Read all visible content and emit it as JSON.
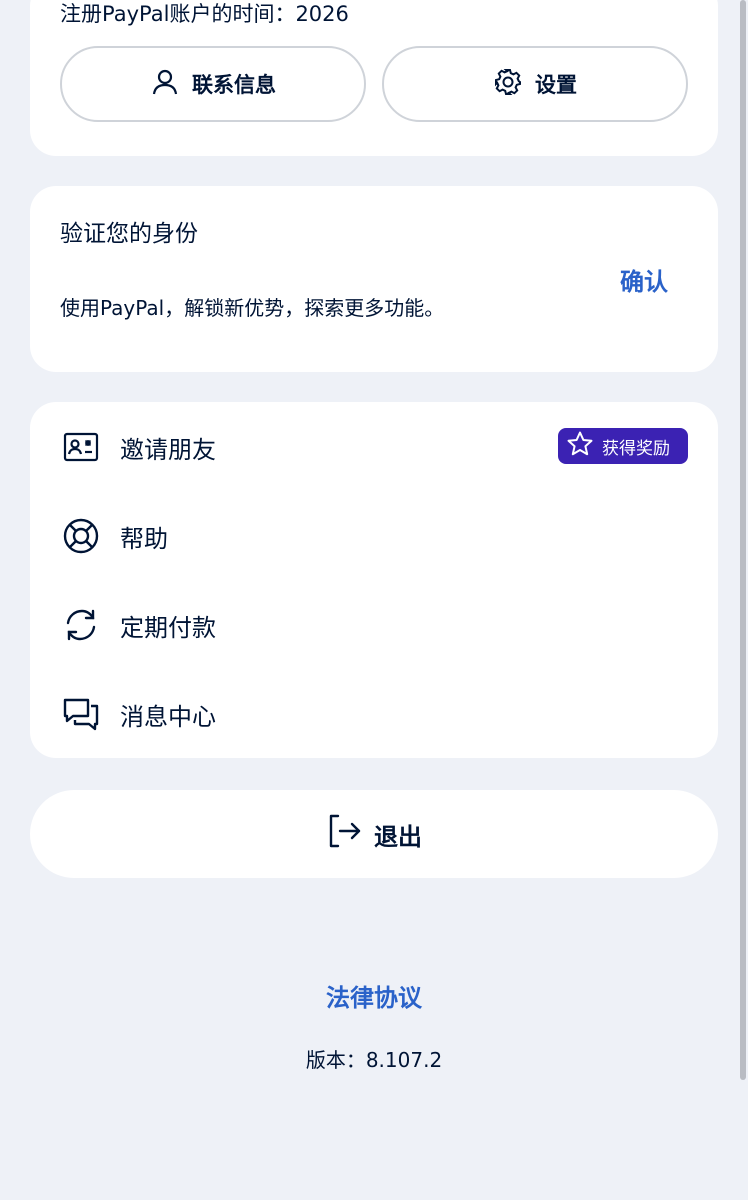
{
  "profile": {
    "registered_text": "注册PayPal账户的时间：2026",
    "contact_label": "联系信息",
    "settings_label": "设置"
  },
  "verify": {
    "title": "验证您的身份",
    "description": "使用PayPal，解锁新优势，探索更多功能。",
    "confirm_label": "确认"
  },
  "menu": {
    "items": [
      {
        "label": "邀请朋友",
        "icon": "contact-card-icon"
      },
      {
        "label": "帮助",
        "icon": "lifebuoy-icon"
      },
      {
        "label": "定期付款",
        "icon": "recurring-icon"
      },
      {
        "label": "消息中心",
        "icon": "chat-bubbles-icon"
      }
    ],
    "reward_label": "获得奖励"
  },
  "logout": {
    "label": "退出"
  },
  "footer": {
    "legal_label": "法律协议",
    "version_text": "版本：8.107.2"
  },
  "colors": {
    "background": "#eef1f7",
    "link": "#2a62c9",
    "reward_badge": "#3b22b3",
    "text": "#001435"
  }
}
